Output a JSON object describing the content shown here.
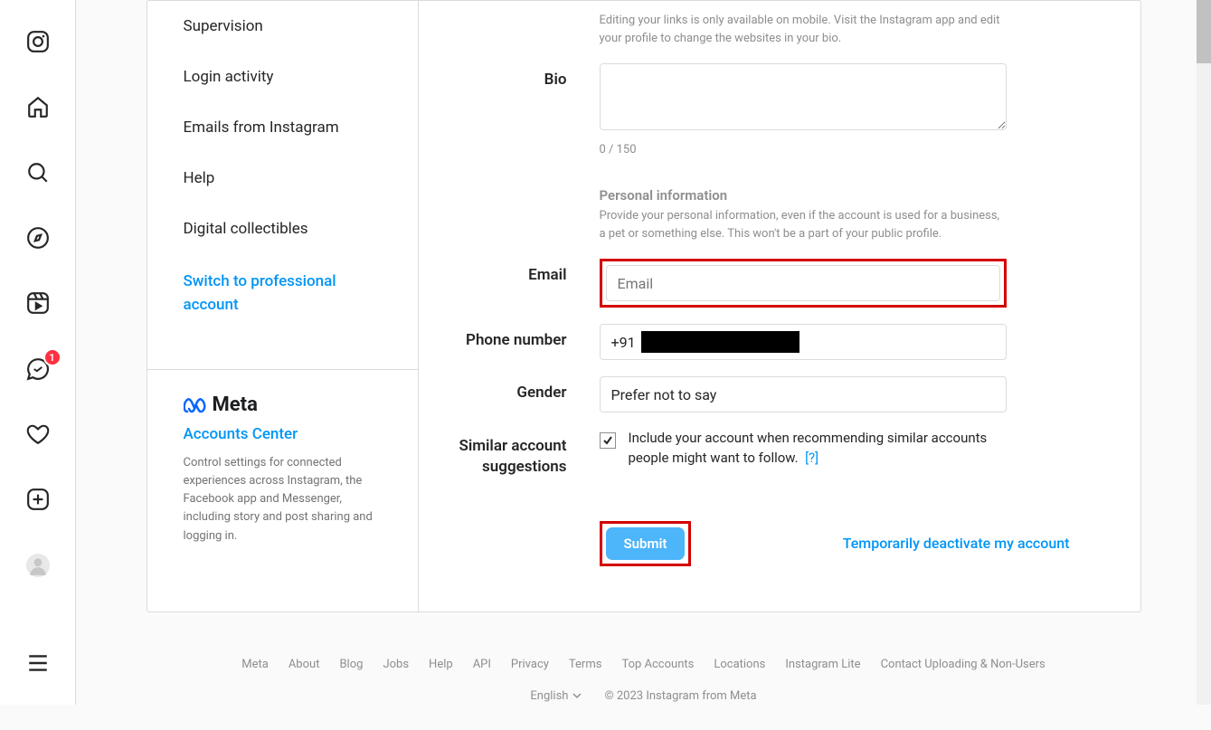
{
  "nav": {
    "messages_badge": "1"
  },
  "sidebar": {
    "items": [
      "Supervision",
      "Login activity",
      "Emails from Instagram",
      "Help",
      "Digital collectibles"
    ],
    "switch_link": "Switch to professional account"
  },
  "meta": {
    "brand": "Meta",
    "accounts_center": "Accounts Center",
    "desc": "Control settings for connected experiences across Instagram, the Facebook app and Messenger, including story and post sharing and logging in."
  },
  "form": {
    "website_hint": "Editing your links is only available on mobile. Visit the Instagram app and edit your profile to change the websites in your bio.",
    "bio_label": "Bio",
    "bio_value": "",
    "bio_count": "0 / 150",
    "personal_heading": "Personal information",
    "personal_desc": "Provide your personal information, even if the account is used for a business, a pet or something else. This won't be a part of your public profile.",
    "email_label": "Email",
    "email_placeholder": "Email",
    "phone_label": "Phone number",
    "phone_prefix": "+91",
    "gender_label": "Gender",
    "gender_value": "Prefer not to say",
    "suggest_label": "Similar account suggestions",
    "suggest_desc": "Include your account when recommending similar accounts people might want to follow.",
    "suggest_help": "[?]",
    "submit": "Submit",
    "deactivate": "Temporarily deactivate my account"
  },
  "footer": {
    "links": [
      "Meta",
      "About",
      "Blog",
      "Jobs",
      "Help",
      "API",
      "Privacy",
      "Terms",
      "Top Accounts",
      "Locations",
      "Instagram Lite",
      "Contact Uploading & Non-Users"
    ],
    "language": "English",
    "copyright": "© 2023 Instagram from Meta"
  }
}
